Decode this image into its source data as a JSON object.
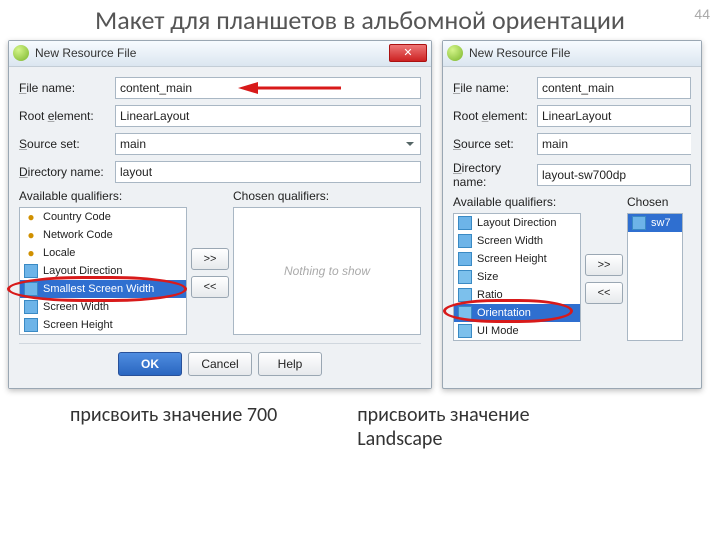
{
  "page_number": "44",
  "slide_title": "Макет для планшетов в альбомной ориентации",
  "dialog_left": {
    "window_title": "New Resource File",
    "file_name_label": "File name:",
    "file_name_value": "content_main",
    "root_element_label": "Root element:",
    "root_element_value": "LinearLayout",
    "source_set_label": "Source set:",
    "source_set_value": "main",
    "directory_name_label": "Directory name:",
    "directory_name_value": "layout",
    "available_label": "Available qualifiers:",
    "chosen_label": "Chosen qualifiers:",
    "nothing": "Nothing to show",
    "add_btn": ">>",
    "remove_btn": "<<",
    "ok": "OK",
    "cancel": "Cancel",
    "help": "Help",
    "qualifiers": {
      "country": "Country Code",
      "network": "Network Code",
      "locale": "Locale",
      "layout_dir": "Layout Direction",
      "smallest": "Smallest Screen Width",
      "screen_w": "Screen Width",
      "screen_h": "Screen Height"
    }
  },
  "dialog_right": {
    "window_title": "New Resource File",
    "file_name_label": "File name:",
    "file_name_value": "content_main",
    "root_element_label": "Root element:",
    "root_element_value": "LinearLayout",
    "source_set_label": "Source set:",
    "source_set_value": "main",
    "directory_name_label": "Directory name:",
    "directory_name_value": "layout-sw700dp",
    "available_label": "Available qualifiers:",
    "chosen_label": "Chosen",
    "add_btn": ">>",
    "remove_btn": "<<",
    "qualifiers": {
      "layout_dir": "Layout Direction",
      "screen_w": "Screen Width",
      "screen_h": "Screen Height",
      "size": "Size",
      "ratio": "Ratio",
      "orientation": "Orientation",
      "ui_mode": "UI Mode"
    },
    "chosen_item": "sw7"
  },
  "caption_left": "присвоить значение 700",
  "caption_right": "присвоить значение Landscape"
}
